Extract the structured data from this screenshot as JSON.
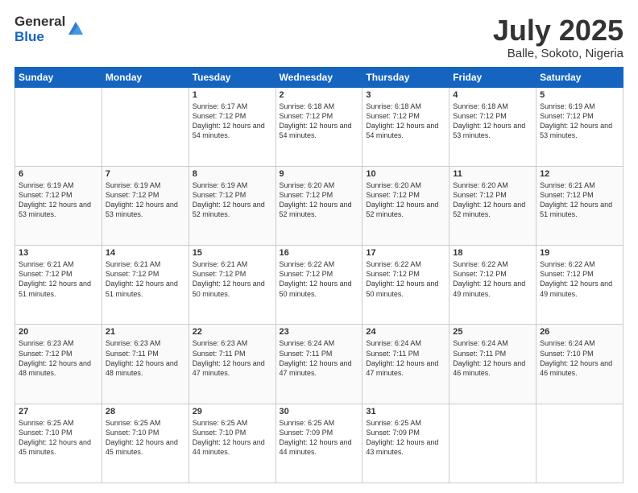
{
  "logo": {
    "general": "General",
    "blue": "Blue"
  },
  "title": "July 2025",
  "location": "Balle, Sokoto, Nigeria",
  "days_of_week": [
    "Sunday",
    "Monday",
    "Tuesday",
    "Wednesday",
    "Thursday",
    "Friday",
    "Saturday"
  ],
  "weeks": [
    [
      {
        "day": "",
        "info": ""
      },
      {
        "day": "",
        "info": ""
      },
      {
        "day": "1",
        "info": "Sunrise: 6:17 AM\nSunset: 7:12 PM\nDaylight: 12 hours\nand 54 minutes."
      },
      {
        "day": "2",
        "info": "Sunrise: 6:18 AM\nSunset: 7:12 PM\nDaylight: 12 hours\nand 54 minutes."
      },
      {
        "day": "3",
        "info": "Sunrise: 6:18 AM\nSunset: 7:12 PM\nDaylight: 12 hours\nand 54 minutes."
      },
      {
        "day": "4",
        "info": "Sunrise: 6:18 AM\nSunset: 7:12 PM\nDaylight: 12 hours\nand 53 minutes."
      },
      {
        "day": "5",
        "info": "Sunrise: 6:19 AM\nSunset: 7:12 PM\nDaylight: 12 hours\nand 53 minutes."
      }
    ],
    [
      {
        "day": "6",
        "info": "Sunrise: 6:19 AM\nSunset: 7:12 PM\nDaylight: 12 hours\nand 53 minutes."
      },
      {
        "day": "7",
        "info": "Sunrise: 6:19 AM\nSunset: 7:12 PM\nDaylight: 12 hours\nand 53 minutes."
      },
      {
        "day": "8",
        "info": "Sunrise: 6:19 AM\nSunset: 7:12 PM\nDaylight: 12 hours\nand 52 minutes."
      },
      {
        "day": "9",
        "info": "Sunrise: 6:20 AM\nSunset: 7:12 PM\nDaylight: 12 hours\nand 52 minutes."
      },
      {
        "day": "10",
        "info": "Sunrise: 6:20 AM\nSunset: 7:12 PM\nDaylight: 12 hours\nand 52 minutes."
      },
      {
        "day": "11",
        "info": "Sunrise: 6:20 AM\nSunset: 7:12 PM\nDaylight: 12 hours\nand 52 minutes."
      },
      {
        "day": "12",
        "info": "Sunrise: 6:21 AM\nSunset: 7:12 PM\nDaylight: 12 hours\nand 51 minutes."
      }
    ],
    [
      {
        "day": "13",
        "info": "Sunrise: 6:21 AM\nSunset: 7:12 PM\nDaylight: 12 hours\nand 51 minutes."
      },
      {
        "day": "14",
        "info": "Sunrise: 6:21 AM\nSunset: 7:12 PM\nDaylight: 12 hours\nand 51 minutes."
      },
      {
        "day": "15",
        "info": "Sunrise: 6:21 AM\nSunset: 7:12 PM\nDaylight: 12 hours\nand 50 minutes."
      },
      {
        "day": "16",
        "info": "Sunrise: 6:22 AM\nSunset: 7:12 PM\nDaylight: 12 hours\nand 50 minutes."
      },
      {
        "day": "17",
        "info": "Sunrise: 6:22 AM\nSunset: 7:12 PM\nDaylight: 12 hours\nand 50 minutes."
      },
      {
        "day": "18",
        "info": "Sunrise: 6:22 AM\nSunset: 7:12 PM\nDaylight: 12 hours\nand 49 minutes."
      },
      {
        "day": "19",
        "info": "Sunrise: 6:22 AM\nSunset: 7:12 PM\nDaylight: 12 hours\nand 49 minutes."
      }
    ],
    [
      {
        "day": "20",
        "info": "Sunrise: 6:23 AM\nSunset: 7:12 PM\nDaylight: 12 hours\nand 48 minutes."
      },
      {
        "day": "21",
        "info": "Sunrise: 6:23 AM\nSunset: 7:11 PM\nDaylight: 12 hours\nand 48 minutes."
      },
      {
        "day": "22",
        "info": "Sunrise: 6:23 AM\nSunset: 7:11 PM\nDaylight: 12 hours\nand 47 minutes."
      },
      {
        "day": "23",
        "info": "Sunrise: 6:24 AM\nSunset: 7:11 PM\nDaylight: 12 hours\nand 47 minutes."
      },
      {
        "day": "24",
        "info": "Sunrise: 6:24 AM\nSunset: 7:11 PM\nDaylight: 12 hours\nand 47 minutes."
      },
      {
        "day": "25",
        "info": "Sunrise: 6:24 AM\nSunset: 7:11 PM\nDaylight: 12 hours\nand 46 minutes."
      },
      {
        "day": "26",
        "info": "Sunrise: 6:24 AM\nSunset: 7:10 PM\nDaylight: 12 hours\nand 46 minutes."
      }
    ],
    [
      {
        "day": "27",
        "info": "Sunrise: 6:25 AM\nSunset: 7:10 PM\nDaylight: 12 hours\nand 45 minutes."
      },
      {
        "day": "28",
        "info": "Sunrise: 6:25 AM\nSunset: 7:10 PM\nDaylight: 12 hours\nand 45 minutes."
      },
      {
        "day": "29",
        "info": "Sunrise: 6:25 AM\nSunset: 7:10 PM\nDaylight: 12 hours\nand 44 minutes."
      },
      {
        "day": "30",
        "info": "Sunrise: 6:25 AM\nSunset: 7:09 PM\nDaylight: 12 hours\nand 44 minutes."
      },
      {
        "day": "31",
        "info": "Sunrise: 6:25 AM\nSunset: 7:09 PM\nDaylight: 12 hours\nand 43 minutes."
      },
      {
        "day": "",
        "info": ""
      },
      {
        "day": "",
        "info": ""
      }
    ]
  ]
}
